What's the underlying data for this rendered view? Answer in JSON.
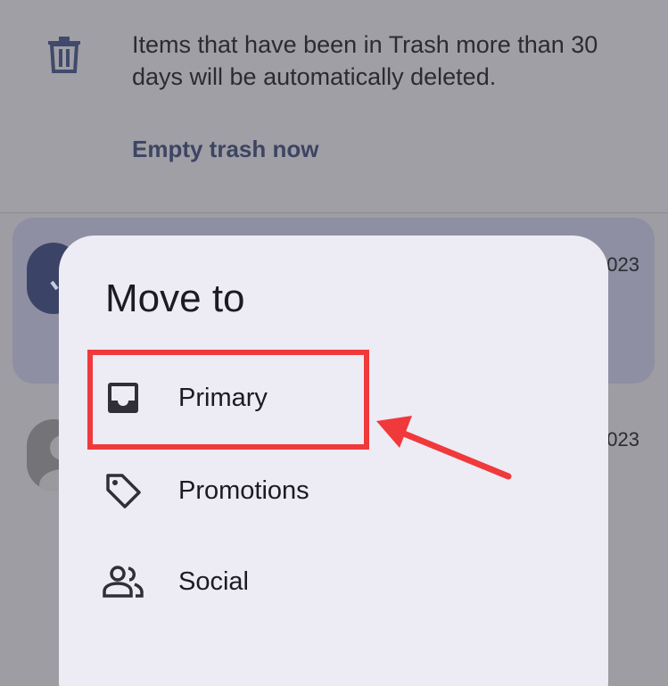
{
  "banner": {
    "icon": "trash-icon",
    "message": "Items that have been in Trash more than 30 days will be automatically deleted.",
    "action_label": "Empty trash now"
  },
  "background_rows": [
    {
      "date_fragment": "023",
      "avatar": "check-icon"
    },
    {
      "date_fragment": "023",
      "avatar": "person-icon"
    }
  ],
  "sheet": {
    "title": "Move to",
    "options": [
      {
        "label": "Primary",
        "icon": "inbox-icon"
      },
      {
        "label": "Promotions",
        "icon": "tag-icon"
      },
      {
        "label": "Social",
        "icon": "people-icon"
      }
    ]
  },
  "annotation": {
    "highlight_color": "#f0393b",
    "highlighted_option": "Primary"
  },
  "colors": {
    "scrim": "#9e9da3",
    "sheet_background": "#edebf4",
    "link": "#3c4563",
    "selected_row": "#8f8fa3"
  }
}
